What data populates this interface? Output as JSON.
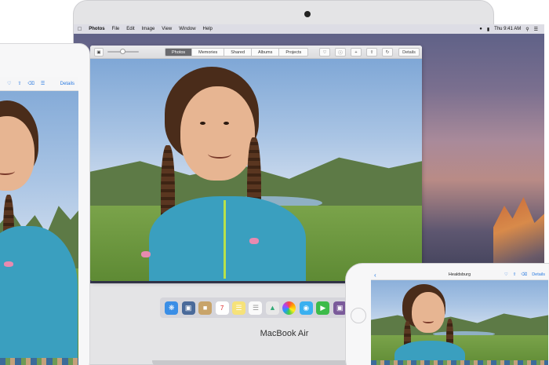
{
  "mac": {
    "menubar": {
      "apple": "",
      "app": "Photos",
      "items": [
        "File",
        "Edit",
        "Image",
        "View",
        "Window",
        "Help"
      ],
      "clock": "Thu 9:41 AM"
    },
    "toolbar": {
      "tabs": [
        "Photos",
        "Memories",
        "Shared",
        "Albums",
        "Projects"
      ],
      "active_tab": "Photos",
      "details": "Details"
    },
    "device_label": "MacBook Air"
  },
  "ipad": {
    "details": "Details"
  },
  "iphone": {
    "title": "Healdsburg",
    "details": "Details"
  },
  "colors": {
    "accent": "#2a7ae0",
    "jacket": "#3a9fbf",
    "hair": "#4a2c1a"
  }
}
